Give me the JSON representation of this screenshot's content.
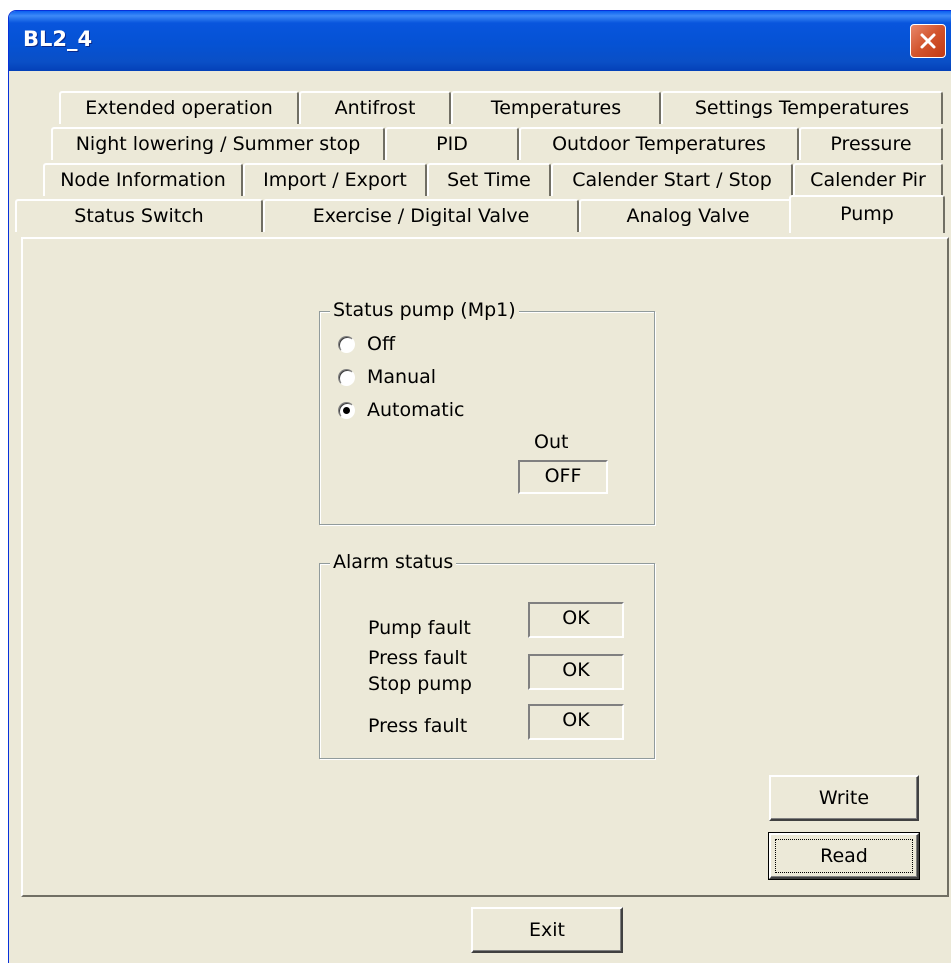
{
  "window": {
    "title": "BL2_4"
  },
  "tabs": {
    "row1": [
      "Extended operation",
      "Antifrost",
      "Temperatures",
      "Settings Temperatures"
    ],
    "row2": [
      "Night lowering / Summer stop",
      "PID",
      "Outdoor Temperatures",
      "Pressure"
    ],
    "row3": [
      "Node Information",
      "Import / Export",
      "Set Time",
      "Calender Start / Stop",
      "Calender Pir"
    ],
    "row4": [
      "Status Switch",
      "Exercise / Digital Valve",
      "Analog Valve",
      "Pump"
    ],
    "active": "Pump"
  },
  "status_group": {
    "title": "Status pump (Mp1)",
    "options": [
      "Off",
      "Manual",
      "Automatic"
    ],
    "selected": "Automatic",
    "out_label": "Out",
    "out_value": "OFF"
  },
  "alarm_group": {
    "title": "Alarm status",
    "rows": [
      {
        "label": "Pump fault",
        "value": "OK"
      },
      {
        "label_line1": "Press fault",
        "label_line2": "Stop pump",
        "value": "OK"
      },
      {
        "label": "Press fault",
        "value": "OK"
      }
    ]
  },
  "buttons": {
    "write": "Write",
    "read": "Read",
    "exit": "Exit"
  },
  "icons": {
    "close": "close-icon"
  },
  "colors": {
    "titlebar": "#0552d4",
    "face": "#ece9d8",
    "close": "#d2542c"
  }
}
